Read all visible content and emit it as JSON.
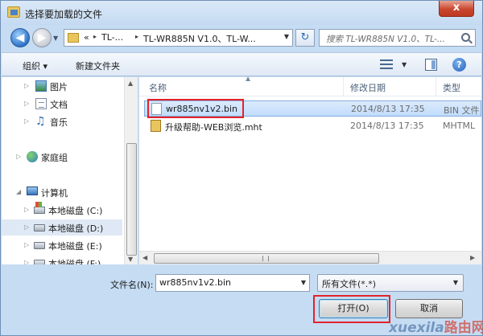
{
  "window": {
    "title": "选择要加载的文件",
    "close_glyph": "x"
  },
  "address": {
    "chevron": "«",
    "segments": [
      "TL-...",
      "TL-WR885N V1.0、TL-W..."
    ],
    "separator": "▸"
  },
  "search": {
    "placeholder": "搜索 TL-WR885N V1.0、TL-..."
  },
  "toolbar": {
    "organize_label": "组织 ▾",
    "new_folder_label": "新建文件夹",
    "help_glyph": "?"
  },
  "sidebar": {
    "items": [
      {
        "label": "图片",
        "icon": "pictures-icon"
      },
      {
        "label": "文档",
        "icon": "documents-icon"
      },
      {
        "label": "音乐",
        "icon": "music-icon"
      },
      {
        "label": "家庭组",
        "icon": "homegroup-icon"
      },
      {
        "label": "计算机",
        "icon": "computer-icon"
      },
      {
        "label": "本地磁盘 (C:)",
        "icon": "drive-c-icon"
      },
      {
        "label": "本地磁盘 (D:)",
        "icon": "drive-icon",
        "selected": true
      },
      {
        "label": "本地磁盘 (E:)",
        "icon": "drive-icon"
      },
      {
        "label": "本地磁盘 (F:)",
        "icon": "drive-icon"
      }
    ]
  },
  "file_list": {
    "columns": [
      "名称",
      "修改日期",
      "类型"
    ],
    "files": [
      {
        "name": "wr885nv1v2.bin",
        "date": "2014/8/13 17:35",
        "type": "BIN 文件",
        "selected": true,
        "icon": "file-bin-icon"
      },
      {
        "name": "升级帮助-WEB浏览.mht",
        "date": "2014/8/13 17:35",
        "type": "MHTML",
        "selected": false,
        "icon": "file-mht-icon"
      }
    ]
  },
  "filename": {
    "label": "文件名(N):",
    "value": "wr885nv1v2.bin"
  },
  "filetype": {
    "value": "所有文件(*.*)"
  },
  "buttons": {
    "open_label": "打开(O)",
    "cancel_label": "取消"
  },
  "watermark": {
    "latin": "xuexila",
    "cn": "路由网"
  },
  "colors": {
    "highlight": "#e2232a",
    "selection": "#c1dcfc",
    "chrome": "#c5dcf3"
  }
}
